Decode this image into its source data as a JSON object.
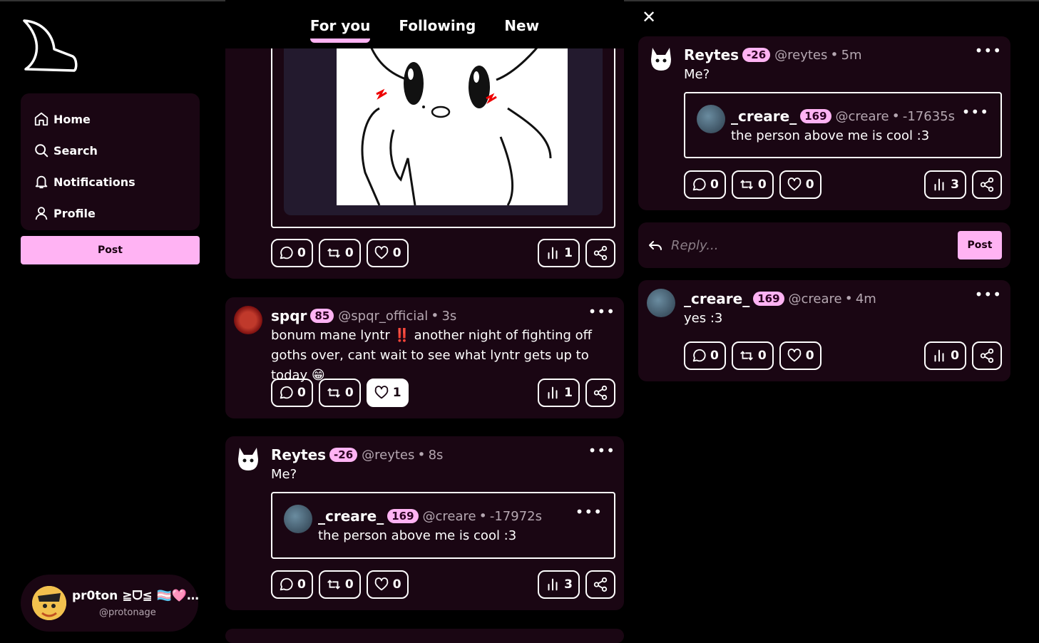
{
  "tabs": [
    {
      "label": "For you",
      "active": true
    },
    {
      "label": "Following",
      "active": false
    },
    {
      "label": "New",
      "active": false
    }
  ],
  "nav": {
    "items": [
      {
        "label": "Home",
        "icon": "home-icon"
      },
      {
        "label": "Search",
        "icon": "search-icon"
      },
      {
        "label": "Notifications",
        "icon": "bell-icon"
      },
      {
        "label": "Profile",
        "icon": "user-icon"
      }
    ],
    "post_label": "Post"
  },
  "current_user": {
    "name": "pr0ton ≧ᗜ≦ 🏳️‍⚧️🩷…",
    "handle": "@protonage"
  },
  "feed": [
    {
      "id": "image-post",
      "actions": {
        "replies": "0",
        "reposts": "0",
        "likes": "0",
        "views": "1"
      }
    },
    {
      "id": "spqr-post",
      "name": "spqr",
      "badge": "85",
      "handle": "@spqr_official",
      "time": "3s",
      "text": "bonum mane lyntr ‼️ another night of fighting off goths over, cant wait to see what lyntr gets up to today 😁",
      "actions": {
        "replies": "0",
        "reposts": "0",
        "likes": "1",
        "views": "1"
      }
    },
    {
      "id": "reytes-post",
      "name": "Reytes",
      "badge": "-26",
      "handle": "@reytes",
      "time": "8s",
      "text": "Me?",
      "quote": {
        "name": "_creare_",
        "badge": "169",
        "handle": "@creare",
        "time": "-17972s",
        "text": "the person above me is cool :3"
      },
      "actions": {
        "replies": "0",
        "reposts": "0",
        "likes": "0",
        "views": "3"
      }
    }
  ],
  "detail": {
    "post": {
      "name": "Reytes",
      "badge": "-26",
      "handle": "@reytes",
      "time": "5m",
      "text": "Me?",
      "quote": {
        "name": "_creare_",
        "badge": "169",
        "handle": "@creare",
        "time": "-17635s",
        "text": "the person above me is cool :3"
      },
      "actions": {
        "replies": "0",
        "reposts": "0",
        "likes": "0",
        "views": "3"
      }
    },
    "reply_placeholder": "Reply...",
    "reply_post_label": "Post",
    "reply": {
      "name": "_creare_",
      "badge": "169",
      "handle": "@creare",
      "time": "4m",
      "text": "yes :3",
      "actions": {
        "replies": "0",
        "reposts": "0",
        "likes": "0",
        "views": "0"
      }
    }
  },
  "colors": {
    "accent": "#ffb3f3",
    "card": "#1a0613",
    "background": "#000000"
  }
}
